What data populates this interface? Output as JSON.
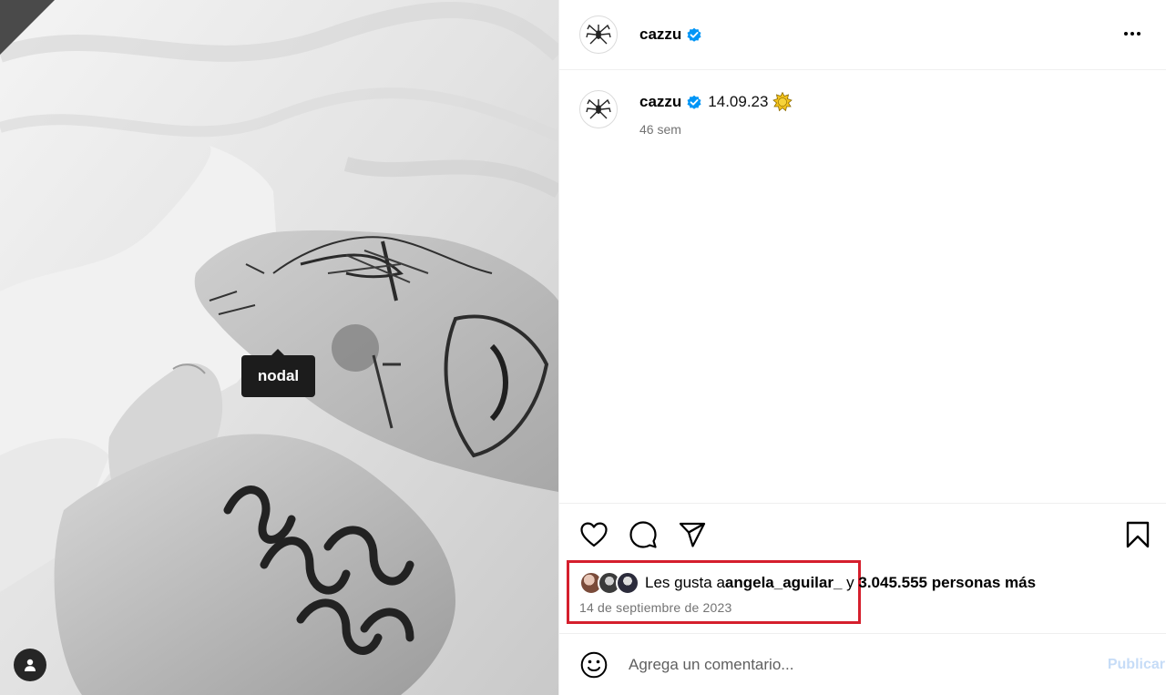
{
  "photo": {
    "tag_label": "nodal",
    "user_tags_icon": "person-icon"
  },
  "post": {
    "header": {
      "username": "cazzu",
      "verified": true,
      "more_icon": "more-horizontal-icon"
    },
    "caption": {
      "username": "cazzu",
      "text": "14.09.23",
      "emoji": "sun-emoji",
      "time_ago": "46 sem"
    },
    "actions": {
      "like_icon": "heart-icon",
      "comment_icon": "comment-icon",
      "share_icon": "send-icon",
      "save_icon": "bookmark-icon"
    },
    "likes": {
      "prefix": "Les gusta a ",
      "liker": "angela_aguilar_",
      "joiner": " y ",
      "others": "3.045.555 personas más"
    },
    "date": "14 de septiembre de 2023",
    "comment": {
      "placeholder": "Agrega un comentario...",
      "publish_label": "Publicar",
      "emoji_icon": "smiley-icon"
    }
  },
  "colors": {
    "verified": "#0095f6",
    "highlight_box": "#d51f2d",
    "publish_disabled": "#c6dcf7",
    "secondary_text": "#737373"
  }
}
